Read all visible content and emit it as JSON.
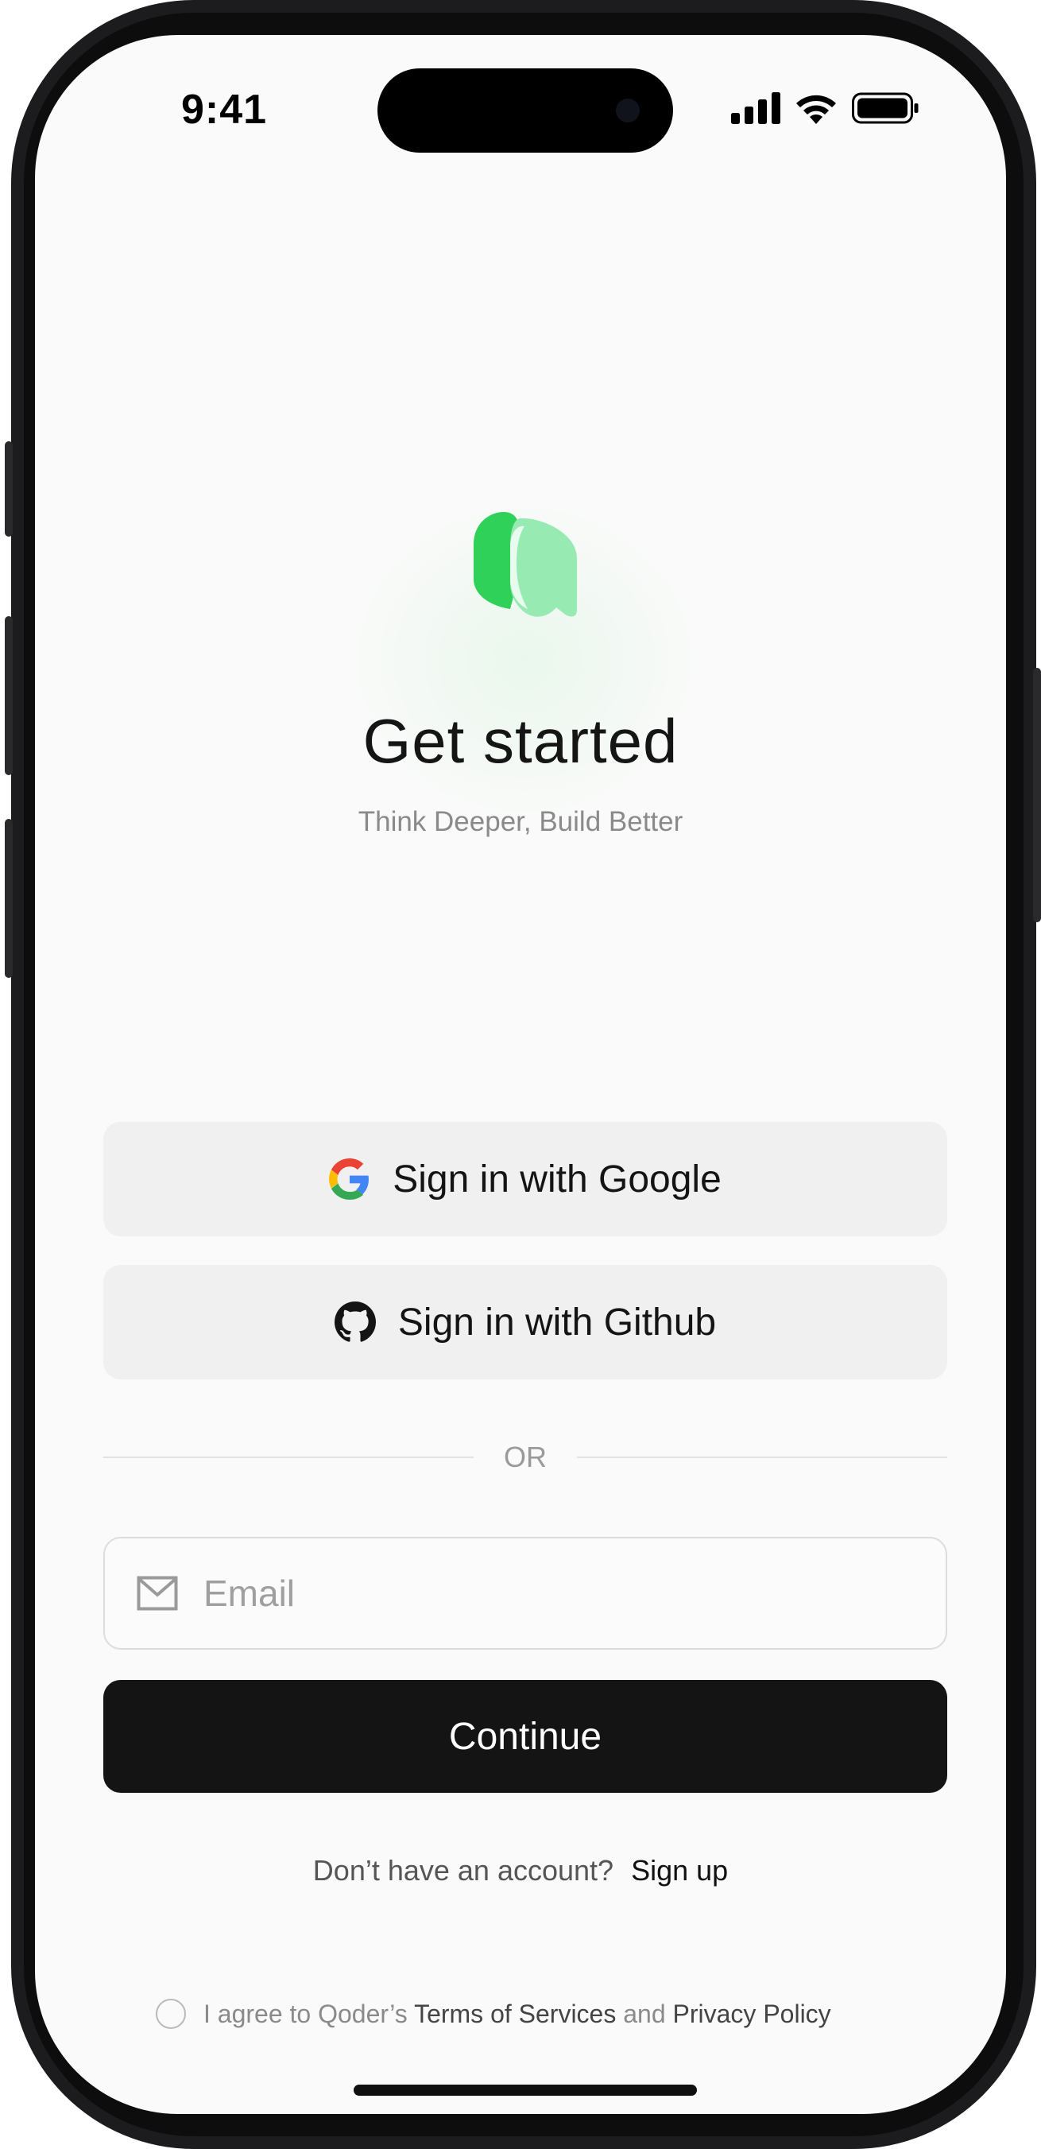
{
  "status_bar": {
    "time": "9:41",
    "icons": [
      "cellular-signal-icon",
      "wifi-icon",
      "battery-icon"
    ]
  },
  "brand": {
    "logo_icon": "qoder-logo-icon",
    "accent_color": "#30D158",
    "accent_light": "#96EAB2"
  },
  "header": {
    "title": "Get started",
    "subtitle": "Think Deeper, Build Better"
  },
  "auth": {
    "google_label": "Sign in with Google",
    "github_label": "Sign in with Github",
    "divider_label": "OR",
    "email_placeholder": "Email",
    "email_value": "",
    "continue_label": "Continue"
  },
  "signup": {
    "prompt": "Don’t have an account?",
    "link_label": "Sign up"
  },
  "terms": {
    "checked": false,
    "prefix": "I agree to Qoder’s",
    "terms_link": "Terms of Services",
    "conjunction": "and",
    "privacy_link": "Privacy Policy"
  }
}
